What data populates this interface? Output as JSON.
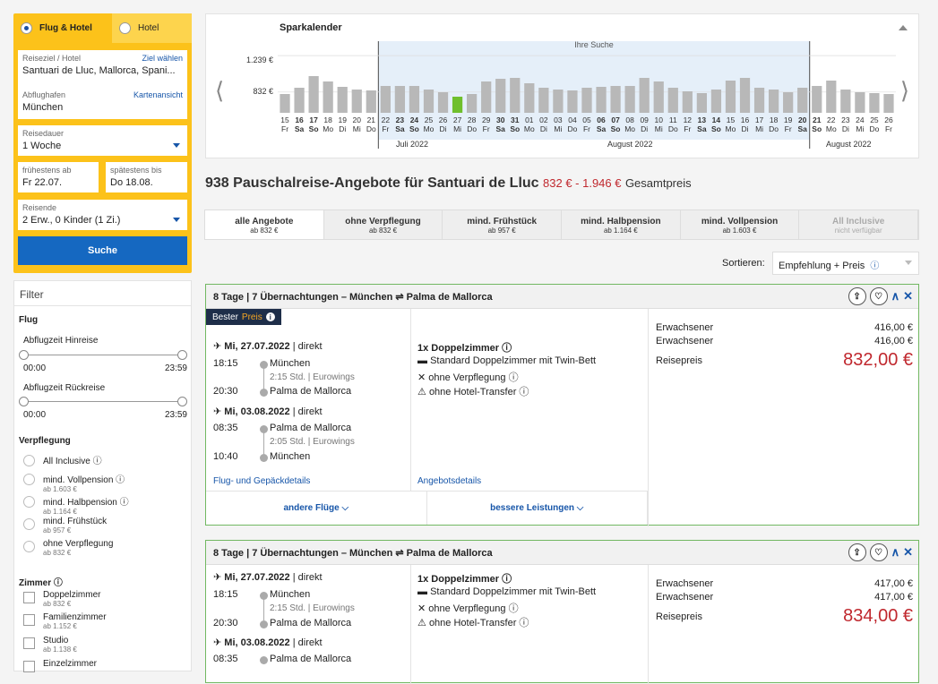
{
  "search": {
    "tab_active": "Flug & Hotel",
    "tab_other": "Hotel",
    "dest_label": "Reiseziel / Hotel",
    "dest_link": "Ziel wählen",
    "dest_value": "Santuari de Lluc, Mallorca, Spani...",
    "airport_label": "Abflughafen",
    "airport_link": "Kartenansicht",
    "airport_value": "München",
    "duration_label": "Reisedauer",
    "duration_value": "1 Woche",
    "from_label": "frühestens ab",
    "from_value": "Fr 22.07.",
    "to_label": "spätestens bis",
    "to_value": "Do 18.08.",
    "travellers_label": "Reisende",
    "travellers_value": "2 Erw., 0 Kinder (1 Zi.)",
    "button": "Suche"
  },
  "filter": {
    "title": "Filter",
    "flight_title": "Flug",
    "outbound_label": "Abflugzeit Hinreise",
    "outbound_min": "00:00",
    "outbound_max": "23:59",
    "return_label": "Abflugzeit Rückreise",
    "return_min": "00:00",
    "return_max": "23:59",
    "board_title": "Verpflegung",
    "board_options": [
      {
        "label": "All Inclusive ⓘ",
        "sub": ""
      },
      {
        "label": "mind. Vollpension ⓘ",
        "sub": "ab 1.603 €"
      },
      {
        "label": "mind. Halbpension ⓘ",
        "sub": "ab 1.164 €"
      },
      {
        "label": "mind. Frühstück",
        "sub": "ab 957 €"
      },
      {
        "label": "ohne Verpflegung",
        "sub": "ab 832 €"
      }
    ],
    "room_title": "Zimmer ⓘ",
    "room_options": [
      {
        "label": "Doppelzimmer",
        "sub": "ab 832 €"
      },
      {
        "label": "Familienzimmer",
        "sub": "ab 1.152 €"
      },
      {
        "label": "Studio",
        "sub": "ab 1.138 €"
      },
      {
        "label": "Einzelzimmer",
        "sub": ""
      }
    ]
  },
  "calendar": {
    "title": "Sparkalender",
    "selection_label": "Ihre Suche",
    "months": [
      "Juli 2022",
      "August 2022",
      "August 2022"
    ]
  },
  "chart_data": {
    "type": "bar",
    "title": "Sparkalender",
    "ylim": [
      600,
      1300
    ],
    "y_ticks": [
      {
        "value": 1239,
        "label": "1.239 €"
      },
      {
        "value": 832,
        "label": "832 €"
      }
    ],
    "bold_days": [
      "16",
      "17",
      "23",
      "24",
      "30",
      "31",
      "06",
      "07",
      "13",
      "14",
      "20",
      "21"
    ],
    "highlight_index": 12,
    "selected_range": [
      7,
      36
    ],
    "days": [
      "15",
      "16",
      "17",
      "18",
      "19",
      "20",
      "21",
      "22",
      "23",
      "24",
      "25",
      "26",
      "27",
      "28",
      "29",
      "30",
      "31",
      "01",
      "02",
      "03",
      "04",
      "05",
      "06",
      "07",
      "08",
      "09",
      "10",
      "11",
      "12",
      "13",
      "14",
      "15",
      "16",
      "17",
      "18",
      "19",
      "20",
      "21",
      "22",
      "23",
      "24",
      "25",
      "26"
    ],
    "weekdays": [
      "Fr",
      "Sa",
      "So",
      "Mo",
      "Di",
      "Mi",
      "Do",
      "Fr",
      "Sa",
      "So",
      "Mo",
      "Di",
      "Mi",
      "Do",
      "Fr",
      "Sa",
      "So",
      "Mo",
      "Di",
      "Mi",
      "Do",
      "Fr",
      "Sa",
      "So",
      "Mo",
      "Di",
      "Mi",
      "Do",
      "Fr",
      "Sa",
      "So",
      "Mo",
      "Di",
      "Mi",
      "Do",
      "Fr",
      "Sa",
      "So",
      "Mo",
      "Di",
      "Mi",
      "Do",
      "Fr"
    ],
    "values": [
      810,
      880,
      1010,
      950,
      890,
      860,
      850,
      900,
      900,
      900,
      860,
      830,
      780,
      810,
      950,
      980,
      990,
      930,
      880,
      860,
      850,
      880,
      890,
      900,
      900,
      990,
      950,
      880,
      840,
      820,
      860,
      960,
      990,
      880,
      860,
      830,
      880,
      900,
      960,
      860,
      830,
      820,
      810
    ]
  },
  "headline": {
    "title": "938 Pauschalreise-Angebote für Santuari de Lluc",
    "price_range": "832 € - 1.946 €",
    "suffix": "Gesamtpreis"
  },
  "catering_tabs": [
    {
      "label": "alle Angebote",
      "sub": "ab 832 €"
    },
    {
      "label": "ohne Verpflegung",
      "sub": "ab 832 €"
    },
    {
      "label": "mind. Frühstück",
      "sub": "ab 957 €"
    },
    {
      "label": "mind. Halbpension",
      "sub": "ab 1.164 €"
    },
    {
      "label": "mind. Vollpension",
      "sub": "ab 1.603 €"
    },
    {
      "label": "All Inclusive",
      "sub": "nicht verfügbar"
    }
  ],
  "sort": {
    "label": "Sortieren:",
    "value": "Empfehlung + Preis"
  },
  "offers": [
    {
      "header": "8 Tage | 7 Übernachtungen – München ⇌ Palma de Mallorca",
      "badge_a": "Bester",
      "badge_b": "Preis",
      "out_date": "Mi, 27.07.2022",
      "out_type": "| direkt",
      "out_dep_time": "18:15",
      "out_dep": "München",
      "out_dur": "2:15 Std. | Eurowings",
      "out_arr_time": "20:30",
      "out_arr": "Palma de Mallorca",
      "ret_date": "Mi, 03.08.2022",
      "ret_type": "| direkt",
      "ret_dep_time": "08:35",
      "ret_dep": "Palma de Mallorca",
      "ret_dur": "2:05 Std. | Eurowings",
      "ret_arr_time": "10:40",
      "ret_arr": "München",
      "flight_link": "Flug- und Gepäckdetails",
      "room_title": "1x Doppelzimmer ⓘ",
      "room_type": "Standard Doppelzimmer mit Twin-Bett",
      "board": "ohne Verpflegung ⓘ",
      "transfer": "ohne Hotel-Transfer ⓘ",
      "offer_link": "Angebotsdetails",
      "adult1_label": "Erwachsener",
      "adult1_price": "416,00 €",
      "adult2_label": "Erwachsener",
      "adult2_price": "416,00 €",
      "total_label": "Reisepreis",
      "total_price": "832,00 €",
      "more_flights": "andere Flüge ⌵",
      "better": "bessere Leistungen ⌵"
    },
    {
      "header": "8 Tage | 7 Übernachtungen – München ⇌ Palma de Mallorca",
      "out_date": "Mi, 27.07.2022",
      "out_type": "| direkt",
      "out_dep_time": "18:15",
      "out_dep": "München",
      "out_dur": "2:15 Std. | Eurowings",
      "out_arr_time": "20:30",
      "out_arr": "Palma de Mallorca",
      "ret_date": "Mi, 03.08.2022",
      "ret_type": "| direkt",
      "ret_dep_time": "08:35",
      "ret_dep": "Palma de Mallorca",
      "room_title": "1x Doppelzimmer ⓘ",
      "room_type": "Standard Doppelzimmer mit Twin-Bett",
      "board": "ohne Verpflegung ⓘ",
      "transfer": "ohne Hotel-Transfer ⓘ",
      "adult1_label": "Erwachsener",
      "adult1_price": "417,00 €",
      "adult2_label": "Erwachsener",
      "adult2_price": "417,00 €",
      "total_label": "Reisepreis",
      "total_price": "834,00 €"
    }
  ]
}
